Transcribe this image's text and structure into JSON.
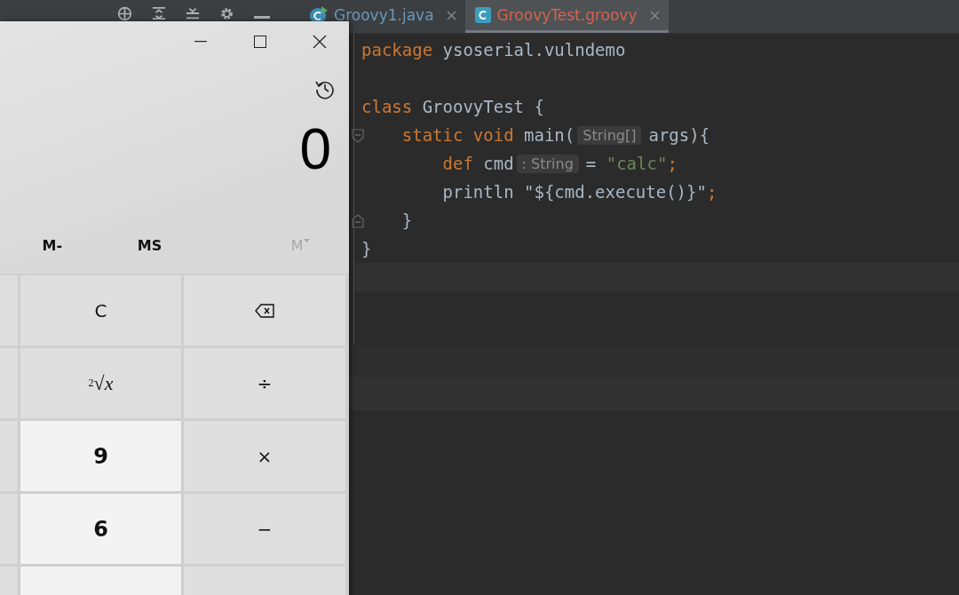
{
  "tabs": [
    {
      "label": "Groovy1.java",
      "selected": false,
      "kind": "java",
      "color": "#6897bb"
    },
    {
      "label": "GroovyTest.groovy",
      "selected": true,
      "kind": "groovy",
      "color": "#d6624e"
    }
  ],
  "editor": {
    "lines": [
      {
        "kind": "code",
        "segments": [
          {
            "kind": "code",
            "tokens": [
              {
                "kind": "keyword",
                "text": "package "
              },
              {
                "kind": "plain",
                "text": "ysoserial.vulndemo"
              }
            ]
          }
        ]
      },
      {
        "kind": "blank"
      },
      {
        "kind": "code",
        "segments": [
          {
            "kind": "code",
            "tokens": [
              {
                "kind": "keyword",
                "text": "class "
              },
              {
                "kind": "plain",
                "text": "GroovyTest {"
              }
            ]
          }
        ]
      },
      {
        "kind": "code",
        "fold_start": true,
        "segments": [
          {
            "kind": "code",
            "tokens": [
              {
                "kind": "keyword",
                "text": "    static void "
              },
              {
                "kind": "plain",
                "text": "main("
              }
            ]
          },
          {
            "kind": "hint",
            "text": "String[]"
          },
          {
            "kind": "code",
            "tokens": [
              {
                "kind": "plain",
                "text": "args){"
              }
            ]
          }
        ]
      },
      {
        "kind": "code",
        "segments": [
          {
            "kind": "code",
            "tokens": [
              {
                "kind": "keyword",
                "text": "        def "
              },
              {
                "kind": "plain",
                "text": "cmd"
              }
            ]
          },
          {
            "kind": "hint",
            "text": ": String"
          },
          {
            "kind": "code",
            "tokens": [
              {
                "kind": "plain",
                "text": "= "
              },
              {
                "kind": "string",
                "text": "\"calc\""
              },
              {
                "kind": "keyword",
                "text": ";"
              }
            ]
          }
        ]
      },
      {
        "kind": "code",
        "segments": [
          {
            "kind": "code",
            "tokens": [
              {
                "kind": "plain",
                "text": "        println \"${cmd.execute()}\""
              },
              {
                "kind": "keyword",
                "text": ";"
              }
            ]
          }
        ]
      },
      {
        "kind": "code",
        "fold_end": true,
        "segments": [
          {
            "kind": "code",
            "tokens": [
              {
                "kind": "plain",
                "text": "    }"
              }
            ]
          }
        ]
      },
      {
        "kind": "code",
        "segments": [
          {
            "kind": "code",
            "tokens": [
              {
                "kind": "plain",
                "text": "}"
              }
            ]
          }
        ]
      },
      {
        "kind": "blank",
        "current": true
      }
    ]
  },
  "calculator": {
    "display": "0",
    "memory": [
      {
        "label": "M-",
        "disabled": false,
        "caret": false
      },
      {
        "label": "MS",
        "disabled": false,
        "caret": false
      },
      {
        "label": "M",
        "disabled": true,
        "caret": true
      }
    ],
    "keys": [
      [
        {
          "kind": "blank"
        },
        {
          "kind": "function",
          "text": "C"
        },
        {
          "kind": "backspace"
        }
      ],
      [
        {
          "kind": "blank"
        },
        {
          "kind": "root",
          "text": "$^{2}$√*x*"
        },
        {
          "kind": "function",
          "text": "÷"
        }
      ],
      [
        {
          "kind": "blank"
        },
        {
          "kind": "digit",
          "text": "9"
        },
        {
          "kind": "function",
          "text": "×"
        }
      ],
      [
        {
          "kind": "blank"
        },
        {
          "kind": "digit",
          "text": "6"
        },
        {
          "kind": "function",
          "text": "−"
        }
      ],
      [
        {
          "kind": "blank"
        },
        {
          "kind": "digitblank"
        },
        {
          "kind": "blank"
        }
      ]
    ]
  }
}
